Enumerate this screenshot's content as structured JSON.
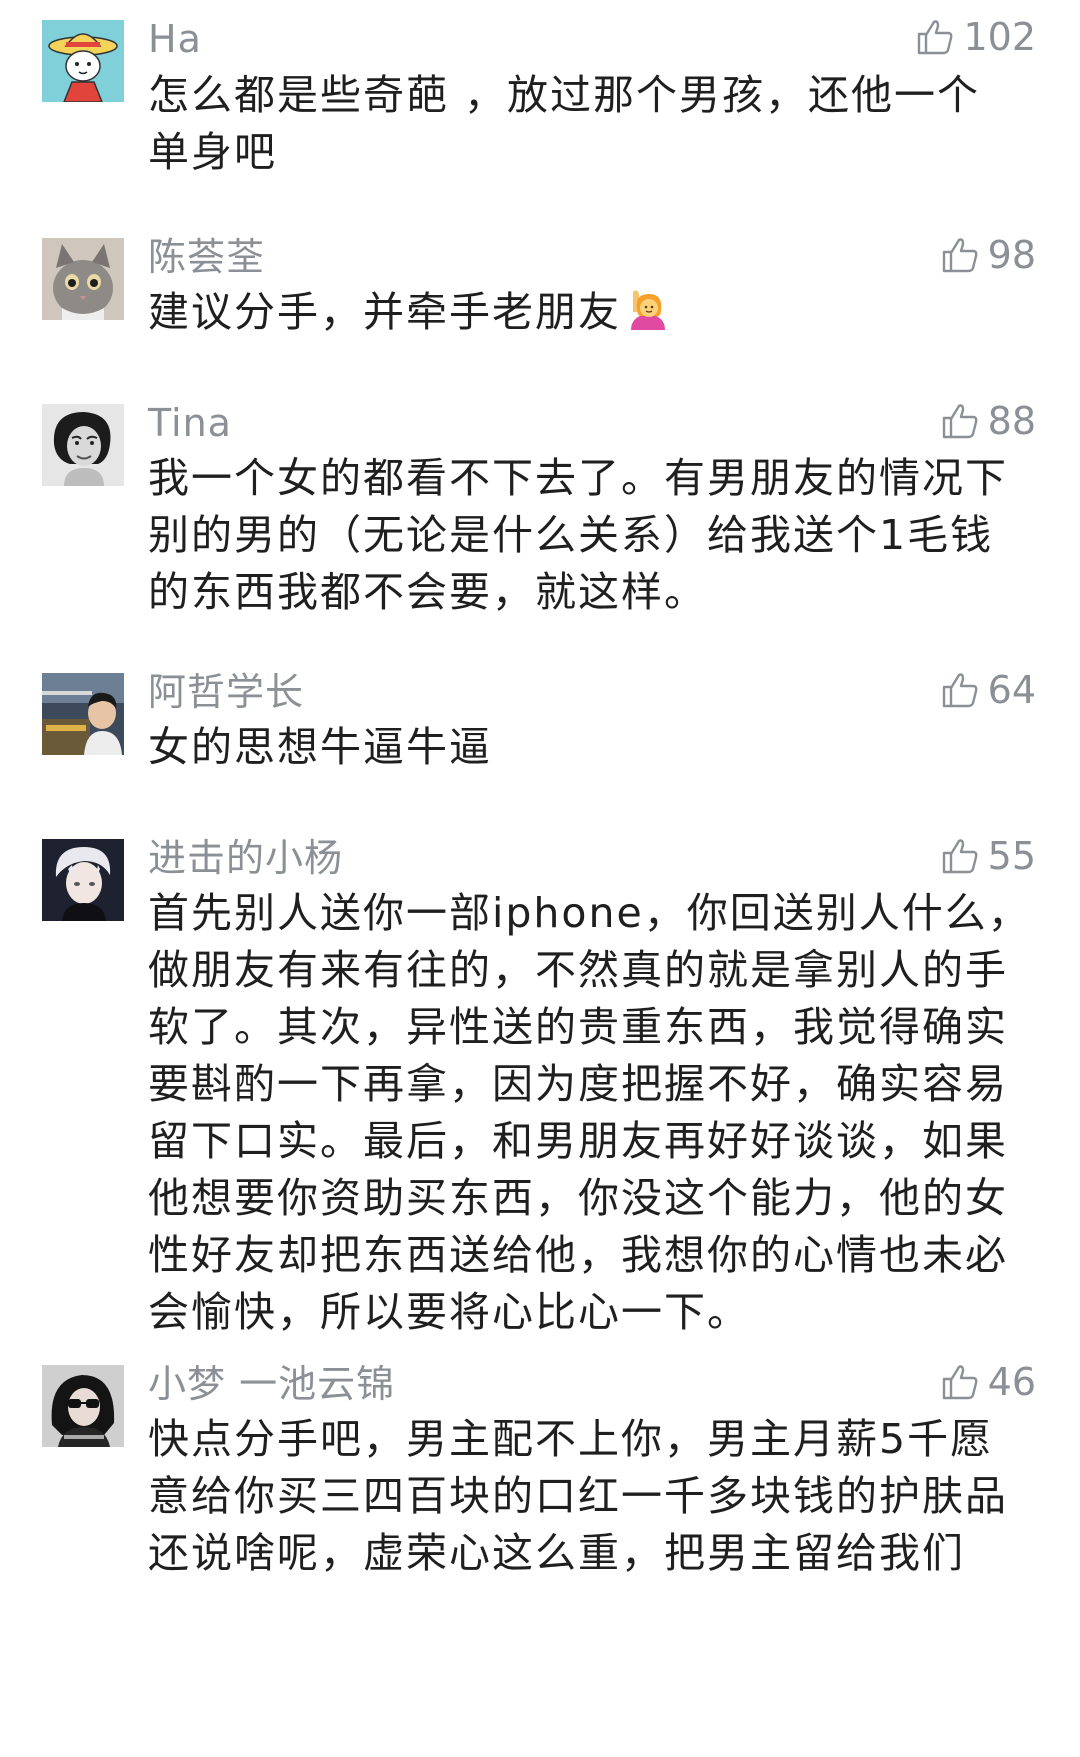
{
  "comments": [
    {
      "username": "Ha",
      "likes": "102",
      "avatar": "cartoon-girl-straw-hat-avatar",
      "lines": [
        "怎么都是些奇葩 ，放过那个男孩，还他一个",
        "单身吧"
      ]
    },
    {
      "username": "陈荟荃",
      "likes": "98",
      "avatar": "cat-avatar",
      "lines": [
        "建议分手，并牵手老朋友"
      ],
      "emoji": "person-raising-hand-emoji"
    },
    {
      "username": "Tina",
      "likes": "88",
      "avatar": "vintage-woman-portrait-avatar",
      "lines": [
        "我一个女的都看不下去了。有男朋友的情况下",
        "别的男的（无论是什么关系）给我送个1毛钱",
        "的东西我都不会要，就这样。"
      ]
    },
    {
      "username": "阿哲学长",
      "likes": "64",
      "avatar": "man-photo-avatar",
      "lines": [
        "女的思想牛逼牛逼"
      ]
    },
    {
      "username": "进击的小杨",
      "likes": "55",
      "avatar": "anime-boy-avatar",
      "lines": [
        "首先别人送你一部iphone，你回送别人什么，",
        "做朋友有来有往的，不然真的就是拿别人的手",
        "软了。其次，异性送的贵重东西，我觉得确实",
        "要斟酌一下再拿，因为度把握不好，确实容易",
        "留下口实。最后，和男朋友再好好谈谈，如果",
        "他想要你资助买东西，你没这个能力，他的女",
        "性好友却把东西送给他，我想你的心情也未必",
        "会愉快，所以要将心比心一下。"
      ]
    },
    {
      "username": "小梦 一池云锦",
      "likes": "46",
      "avatar": "girl-dark-photo-avatar",
      "lines": [
        "快点分手吧，男主配不上你，男主月薪5千愿",
        "意给你买三四百块的口红一千多块钱的护肤品",
        "还说啥呢，虚荣心这么重，把男主留给我们"
      ]
    }
  ],
  "colors": {
    "text": "#1f1f1f",
    "meta": "#8b8f96",
    "background": "#ffffff"
  },
  "icons": {
    "like": "thumbs-up-outline-icon"
  }
}
